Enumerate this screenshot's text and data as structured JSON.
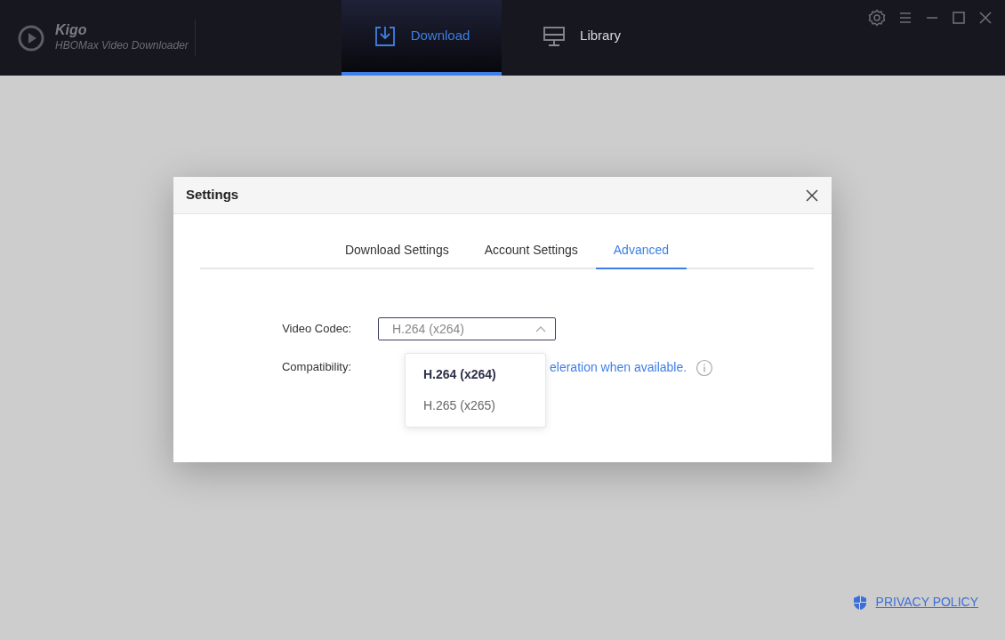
{
  "app": {
    "name": "Kigo",
    "subtitle": "HBOMax Video Downloader"
  },
  "nav_tabs": [
    {
      "label": "Download",
      "selected": true,
      "kind": "download"
    },
    {
      "label": "Library",
      "selected": false,
      "kind": "library"
    }
  ],
  "dialog": {
    "title": "Settings",
    "tabs": [
      {
        "label": "Download Settings",
        "selected": false
      },
      {
        "label": "Account Settings",
        "selected": false
      },
      {
        "label": "Advanced",
        "selected": true
      }
    ],
    "video_codec": {
      "label": "Video Codec:",
      "value": "H.264 (x264)",
      "expanded": true,
      "options": [
        {
          "label": "H.264 (x264)",
          "selected": true
        },
        {
          "label": "H.265 (x265)",
          "selected": false
        }
      ]
    },
    "compatibility": {
      "label": "Compatibility:",
      "text": "eleration when available."
    }
  },
  "footer": {
    "privacy_link": "PRIVACY POLICY"
  }
}
